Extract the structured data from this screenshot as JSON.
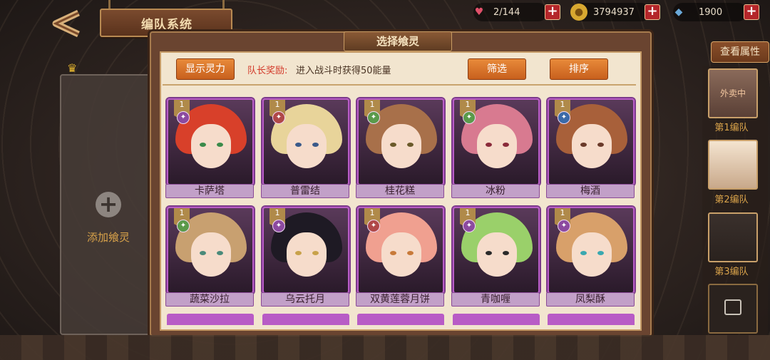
{
  "header": {
    "title": "编队系统"
  },
  "resources": [
    {
      "name": "stamina",
      "icon": "heart-icon",
      "value": "2/144",
      "color": "#e0506a"
    },
    {
      "name": "gold",
      "icon": "coin-icon",
      "value": "3794937",
      "color": "#d8a830"
    },
    {
      "name": "gem",
      "icon": "crystal-icon",
      "value": "1900",
      "color": "#6aa8d8"
    }
  ],
  "left_slot": {
    "label": "添加飨灵"
  },
  "modal": {
    "title": "选择飨灵",
    "show_power_btn": "显示灵力",
    "bonus_key": "队长奖励:",
    "bonus_text": "进入战斗时获得50能量",
    "filter_btn": "筛选",
    "sort_btn": "排序"
  },
  "cards": [
    {
      "name": "卡萨塔",
      "level": "1",
      "element": "purple",
      "hair": "#d8402a",
      "eye": "#3a8a4a"
    },
    {
      "name": "普雷结",
      "level": "1",
      "element": "red",
      "hair": "#e8d49a",
      "eye": "#3a5a8a"
    },
    {
      "name": "桂花糕",
      "level": "1",
      "element": "green",
      "hair": "#a8704a",
      "eye": "#6a5a2a"
    },
    {
      "name": "冰粉",
      "level": "1",
      "element": "green",
      "hair": "#d87a90",
      "eye": "#8a2a3a"
    },
    {
      "name": "梅酒",
      "level": "1",
      "element": "blue",
      "hair": "#a8603a",
      "eye": "#6a3a2a"
    },
    {
      "name": "蔬菜沙拉",
      "level": "1",
      "element": "green",
      "hair": "#c8a070",
      "eye": "#4a8a7a"
    },
    {
      "name": "乌云托月",
      "level": "1",
      "element": "purple",
      "hair": "#1e1a24",
      "eye": "#c8a24a"
    },
    {
      "name": "双黄莲蓉月饼",
      "level": "1",
      "element": "red",
      "hair": "#f0a090",
      "eye": "#c87a3a"
    },
    {
      "name": "青咖喱",
      "level": "1",
      "element": "purple",
      "hair": "#9ad06a",
      "eye": "#2a2a2a"
    },
    {
      "name": "凤梨酥",
      "level": "1",
      "element": "purple",
      "hair": "#d8a06a",
      "eye": "#3aa8b0"
    }
  ],
  "right_panel": {
    "attr_btn": "查看属性",
    "teams": [
      {
        "label": "第1编队",
        "badge": "外卖中"
      },
      {
        "label": "第2编队"
      },
      {
        "label": "第3编队"
      }
    ]
  }
}
